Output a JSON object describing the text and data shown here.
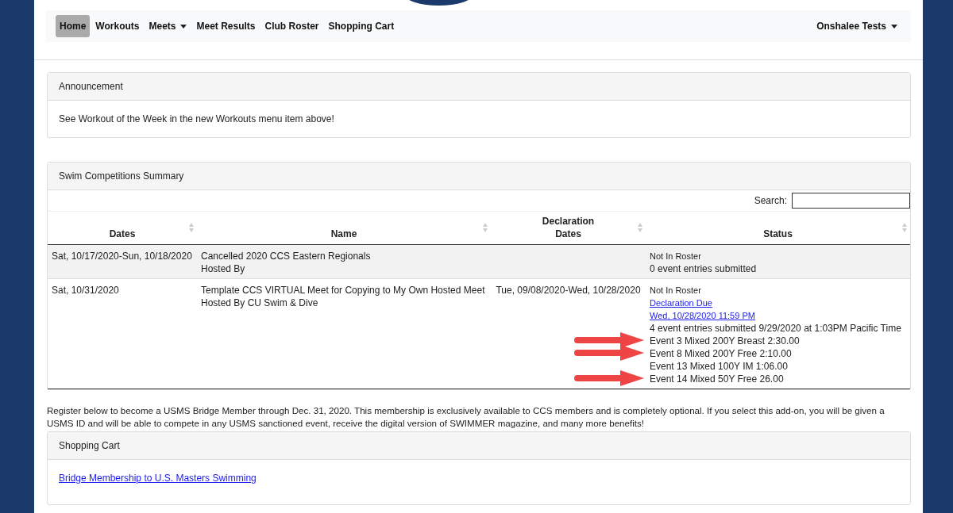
{
  "nav": {
    "items": [
      {
        "label": "Home",
        "selected": true,
        "dropdown": false
      },
      {
        "label": "Workouts",
        "selected": false,
        "dropdown": false
      },
      {
        "label": "Meets",
        "selected": false,
        "dropdown": true
      },
      {
        "label": "Meet Results",
        "selected": false,
        "dropdown": false
      },
      {
        "label": "Club Roster",
        "selected": false,
        "dropdown": false
      },
      {
        "label": "Shopping Cart",
        "selected": false,
        "dropdown": false
      }
    ],
    "user": "Onshalee Tests"
  },
  "announcement": {
    "title": "Announcement",
    "text": "See Workout of the Week in the new Workouts menu item above!"
  },
  "competitions": {
    "title": "Swim Competitions Summary",
    "search_label": "Search:",
    "columns": [
      "Dates",
      "Name",
      "Declaration Dates",
      "Status"
    ],
    "rows": [
      {
        "dates": "Sat, 10/17/2020-Sun, 10/18/2020",
        "name": [
          "Cancelled 2020 CCS Eastern Regionals",
          "Hosted By"
        ],
        "declaration": "",
        "status": [
          {
            "kind": "note",
            "text": "Not In Roster",
            "arrow": false
          },
          {
            "kind": "text",
            "text": "0 event entries submitted",
            "arrow": false
          }
        ]
      },
      {
        "dates": "Sat, 10/31/2020",
        "name": [
          "Template CCS VIRTUAL Meet for Copying to My Own Hosted Meet",
          "Hosted By CU Swim & Dive"
        ],
        "declaration": "Tue, 09/08/2020-Wed, 10/28/2020",
        "status": [
          {
            "kind": "note",
            "text": "Not In Roster",
            "arrow": false
          },
          {
            "kind": "link",
            "text": "Declaration Due",
            "arrow": false
          },
          {
            "kind": "link",
            "text": "Wed, 10/28/2020 11:59 PM",
            "arrow": false
          },
          {
            "kind": "text",
            "text": "4 event entries submitted 9/29/2020 at 1:03PM Pacific Time",
            "arrow": false
          },
          {
            "kind": "text",
            "text": "Event 3 Mixed 200Y Breast 2:30.00",
            "arrow": true
          },
          {
            "kind": "text",
            "text": "Event 8 Mixed 200Y Free 2:10.00",
            "arrow": true
          },
          {
            "kind": "text",
            "text": "Event 13 Mixed 100Y IM 1:06.00",
            "arrow": false
          },
          {
            "kind": "text",
            "text": "Event 14 Mixed 50Y Free 26.00",
            "arrow": true
          }
        ]
      }
    ]
  },
  "register_text": "Register below to become a USMS Bridge Member through Dec. 31, 2020.  This membership is exclusively available to CCS members and is completely optional.  If you select this add-on, you will be given a USMS ID and will be able to compete in any USMS sanctioned event, receive the digital version of SWIMMER magazine, and many more benefits!",
  "cart": {
    "title": "Shopping Cart",
    "link": "Bridge Membership to U.S. Masters Swimming"
  }
}
